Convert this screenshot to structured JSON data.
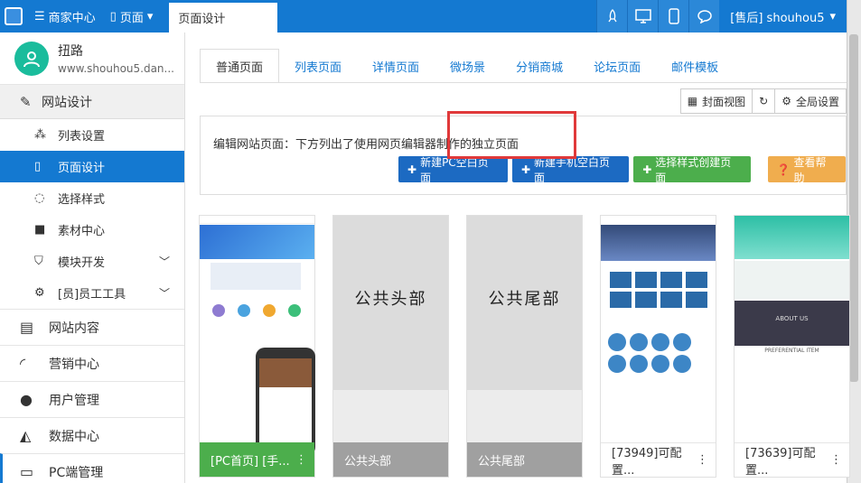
{
  "topbar": {
    "menu_merchant": "商家中心",
    "menu_page": "页面",
    "active_tab": "页面设计",
    "user": "[售后] shouhou5"
  },
  "profile": {
    "name": "扭路",
    "site": "www.shouhou5.dan..."
  },
  "sidebar": {
    "group_site_design": "网站设计",
    "items": [
      {
        "label": "列表设置",
        "icon": "sitemap-icon"
      },
      {
        "label": "页面设计",
        "icon": "file-icon"
      },
      {
        "label": "选择样式",
        "icon": "spinner-icon"
      },
      {
        "label": "素材中心",
        "icon": "folder-icon"
      },
      {
        "label": "模块开发",
        "icon": "html5-icon"
      },
      {
        "label": "[员]员工工具",
        "icon": "gear-icon"
      }
    ],
    "main": [
      {
        "label": "网站内容",
        "icon": "document-icon"
      },
      {
        "label": "营销中心",
        "icon": "signal-icon"
      },
      {
        "label": "用户管理",
        "icon": "user-icon"
      },
      {
        "label": "数据中心",
        "icon": "area-chart-icon"
      },
      {
        "label": "PC端管理",
        "icon": "monitor-icon"
      }
    ]
  },
  "tabs": [
    "普通页面",
    "列表页面",
    "详情页面",
    "微场景",
    "分销商城",
    "论坛页面",
    "邮件模板"
  ],
  "view_buttons": {
    "cover": "封面视图",
    "global": "全局设置"
  },
  "info": {
    "text": "编辑网站页面：下方列出了使用网页编辑器制作的独立页面",
    "btn_new_pc": "新建PC空白页面",
    "btn_new_mobile": "新建手机空白页面",
    "btn_style": "选择样式创建页面",
    "btn_help": "查看帮助"
  },
  "cards": [
    {
      "title": "[PC首页] [手...",
      "placeholder": ""
    },
    {
      "title": "公共头部",
      "placeholder": "公共头部"
    },
    {
      "title": "公共尾部",
      "placeholder": "公共尾部"
    },
    {
      "title": "[73949]可配置...",
      "placeholder": ""
    },
    {
      "title": "[73639]可配置...",
      "placeholder": ""
    }
  ],
  "card5_text": {
    "about": "ABOUT US",
    "pref": "PREFERENTIAL ITEM"
  },
  "colors": {
    "primary": "#1479d1",
    "green": "#4cae4c",
    "orange": "#f0ad4e",
    "highlight": "#e0393a"
  }
}
